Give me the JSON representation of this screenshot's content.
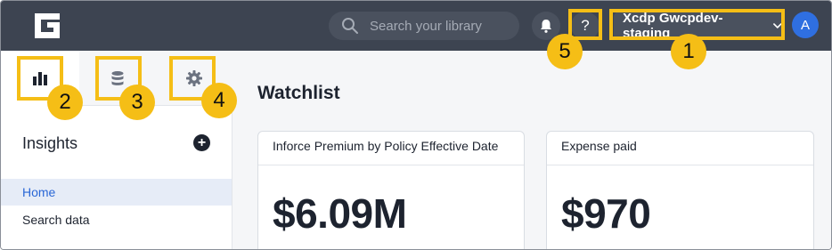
{
  "header": {
    "search_placeholder": "Search your library",
    "help_label": "?",
    "org_name": "Xcdp Gwcpdev-staging",
    "avatar_initial": "A"
  },
  "sidebar": {
    "tabs": [
      {
        "icon": "bar-chart-icon"
      },
      {
        "icon": "database-icon"
      },
      {
        "icon": "gear-icon"
      }
    ],
    "section_title": "Insights",
    "add_label": "+",
    "items": [
      {
        "label": "Home",
        "active": true
      },
      {
        "label": "Search data",
        "active": false
      }
    ]
  },
  "main": {
    "title": "Watchlist",
    "cards": [
      {
        "title": "Inforce Premium by Policy Effective Date",
        "value": "$6.09M"
      },
      {
        "title": "Expense paid",
        "value": "$970"
      }
    ]
  },
  "callouts": [
    "1",
    "2",
    "3",
    "4",
    "5"
  ],
  "colors": {
    "topbar": "#3d4451",
    "callout": "#f5be16",
    "accent": "#2a67d6",
    "avatar": "#2f6fe0"
  }
}
